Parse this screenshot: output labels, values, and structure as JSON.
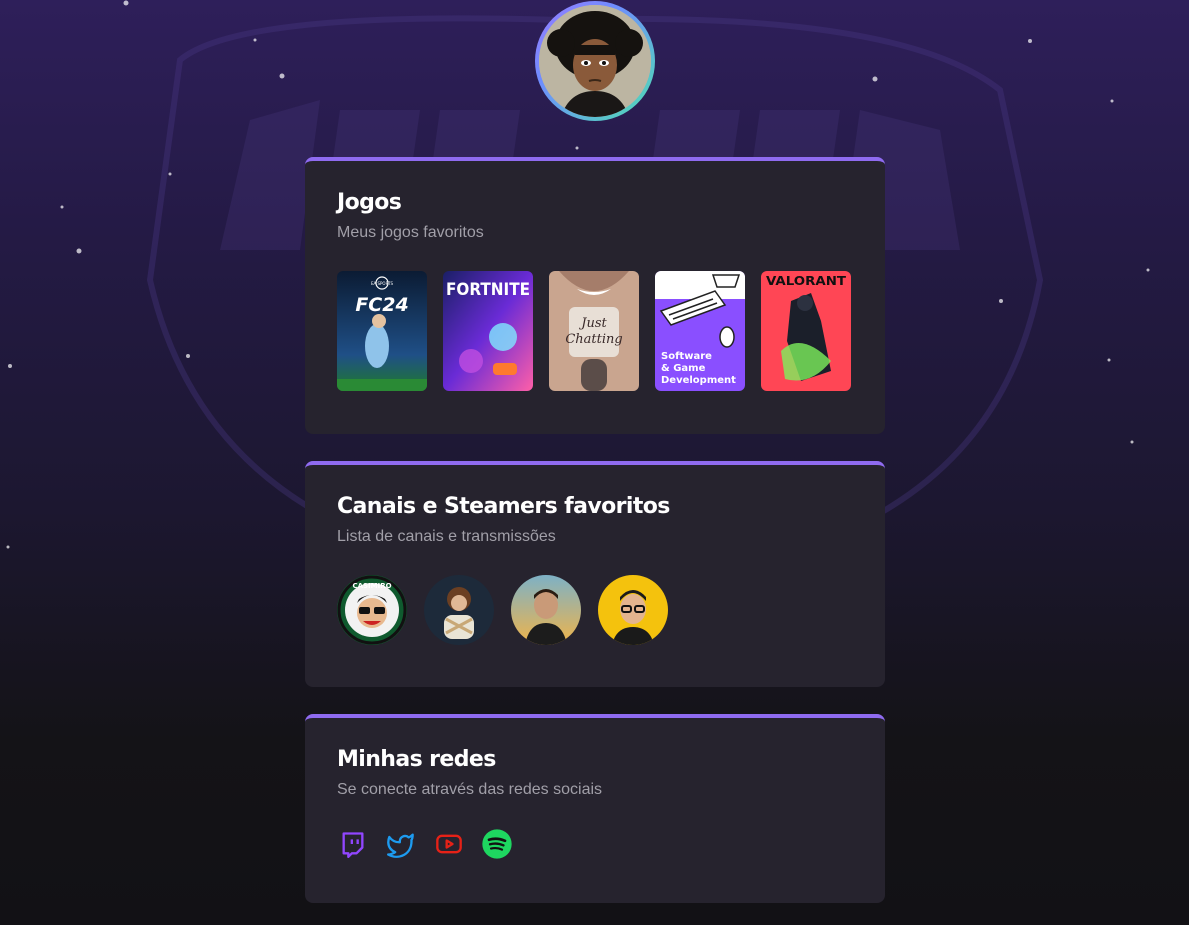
{
  "profile": {
    "avatar_icon": "profile-avatar"
  },
  "games_section": {
    "title": "Jogos",
    "subtitle": "Meus jogos favoritos",
    "items": [
      {
        "name": "FC24",
        "badge": "EA SPORTS",
        "accent": "#0b3b6e"
      },
      {
        "name": "FORTNITE",
        "accent": "#5a2bd6"
      },
      {
        "name": "Just Chatting",
        "accent": "#c49a86"
      },
      {
        "name": "Software & Game Development",
        "line1": "Software",
        "line2": "& Game",
        "line3": "Development",
        "accent": "#8a4fff"
      },
      {
        "name": "VALORANT",
        "accent": "#ff4655"
      }
    ]
  },
  "streamers_section": {
    "title": "Canais e Steamers favoritos",
    "subtitle": "Lista de canais e transmissões",
    "items": [
      {
        "name": "casimiro",
        "ring_text": "CASIMIRO"
      },
      {
        "name": "streamer-2"
      },
      {
        "name": "streamer-3"
      },
      {
        "name": "streamer-4"
      }
    ]
  },
  "social_section": {
    "title": "Minhas redes",
    "subtitle": "Se conecte através das redes sociais",
    "items": [
      {
        "name": "twitch",
        "icon": "twitch-icon",
        "color": "#9146ff"
      },
      {
        "name": "twitter",
        "icon": "twitter-icon",
        "color": "#1d9bf0"
      },
      {
        "name": "youtube",
        "icon": "youtube-icon",
        "color": "#e62117"
      },
      {
        "name": "spotify",
        "icon": "spotify-icon",
        "color": "#1ed760"
      }
    ]
  },
  "colors": {
    "card_bg": "#26232e",
    "card_accent": "#8f6bf0",
    "subtitle": "#a19fa8"
  }
}
